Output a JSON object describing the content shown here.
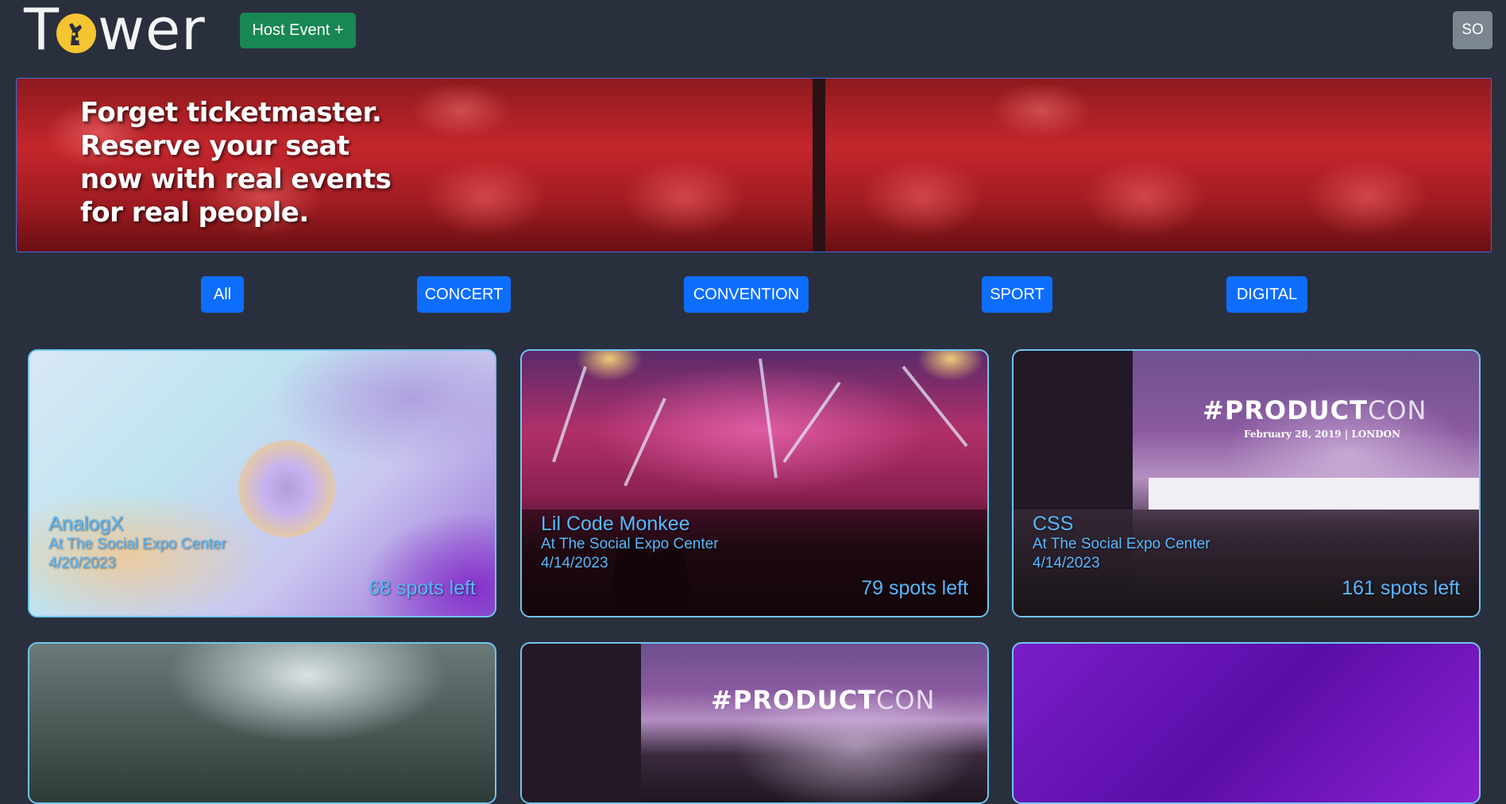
{
  "nav": {
    "logo_text_1": "T",
    "logo_text_2": "wer",
    "host_button": "Host Event +",
    "avatar": "SO"
  },
  "hero": {
    "text": "Forget ticketmaster. Reserve your seat now with real events for real people."
  },
  "filters": [
    "All",
    "CONCERT",
    "CONVENTION",
    "SPORT",
    "DIGITAL"
  ],
  "events": [
    {
      "name": "AnalogX",
      "location": "At The Social Expo Center",
      "date": "4/20/2023",
      "spots": "68 spots left"
    },
    {
      "name": "Lil Code Monkee",
      "location": "At The Social Expo Center",
      "date": "4/14/2023",
      "spots": "79 spots left"
    },
    {
      "name": "CSS",
      "location": "At The Social Expo Center",
      "date": "4/14/2023",
      "spots": "161 spots left"
    }
  ],
  "product_con": {
    "title_bold": "#PRODUCT",
    "title_thin": "CON",
    "subtitle": "February 28, 2019 | LONDON"
  },
  "colors": {
    "background": "#2a2f3d",
    "host_button": "#198754",
    "filter_button": "#0d6efd",
    "card_text": "#58b8ff",
    "card_border": "#6ec6f0"
  }
}
